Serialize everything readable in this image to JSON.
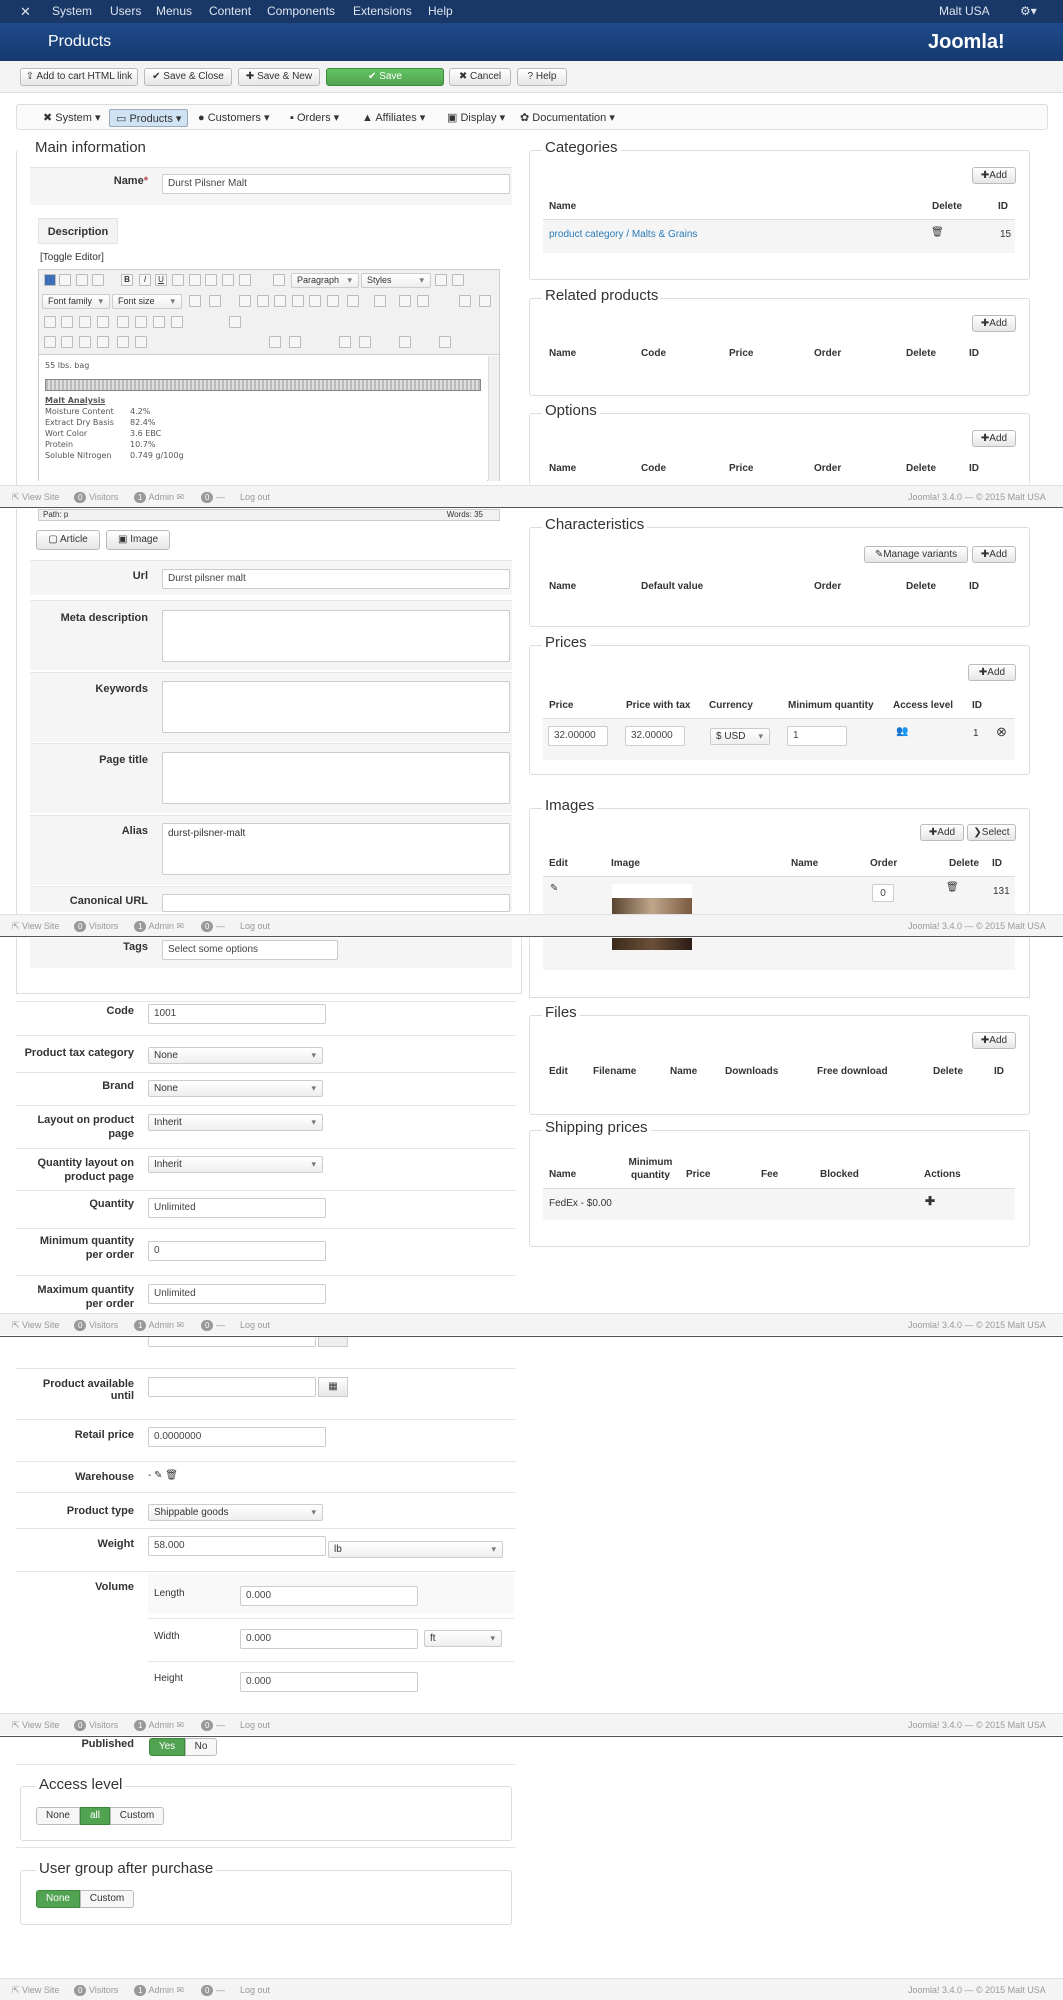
{
  "topnav": {
    "menus": [
      "System",
      "Users",
      "Menus",
      "Content",
      "Components",
      "Extensions",
      "Help"
    ],
    "site": "Malt USA"
  },
  "title": "Products",
  "brand": "Joomla!",
  "toolbar": {
    "add_to_cart": "Add to cart HTML link",
    "save_close": "Save & Close",
    "save_new": "Save & New",
    "save": "Save",
    "cancel": "Cancel",
    "help": "Help"
  },
  "tabs": [
    "System",
    "Products",
    "Customers",
    "Orders",
    "Affiliates",
    "Display",
    "Documentation"
  ],
  "main": {
    "heading": "Main information",
    "name_label": "Name",
    "name_required": "*",
    "name_value": "Durst Pilsner Malt",
    "description_tab": "Description",
    "toggle_editor": "[Toggle Editor]",
    "paragraph_select": "Paragraph",
    "styles_select": "Styles",
    "font_family_select": "Font family",
    "font_size_select": "Font size",
    "editor_lines": {
      "bag": "55 lbs. bag",
      "analysis_title": "Malt Analysis",
      "rows": [
        [
          "Moisture Content",
          "4.2%"
        ],
        [
          "Extract Dry Basis",
          "82.4%"
        ],
        [
          "Wort Color",
          "3.6 EBC"
        ],
        [
          "Protein",
          "10.7%"
        ],
        [
          "Soluble Nitrogen",
          "0.749 g/100g"
        ]
      ]
    },
    "path": "Path:",
    "path_value": "p",
    "words": "Words: 35",
    "article_btn": "Article",
    "image_btn": "Image",
    "url_label": "Url",
    "url_value": "Durst pilsner malt",
    "meta_desc_label": "Meta description",
    "keywords_label": "Keywords",
    "page_title_label": "Page title",
    "alias_label": "Alias",
    "alias_value": "durst-pilsner-malt",
    "canonical_label": "Canonical URL",
    "tags_label": "Tags",
    "tags_placeholder": "Select some options"
  },
  "fields": {
    "code_label": "Code",
    "code_value": "1001",
    "tax_label": "Product tax category",
    "tax_value": "None",
    "brand_label": "Brand",
    "brand_value": "None",
    "layout_label": "Layout on product page",
    "layout_value": "Inherit",
    "qty_layout_label": "Quantity layout on product page",
    "qty_layout_value": "Inherit",
    "quantity_label": "Quantity",
    "quantity_value": "Unlimited",
    "min_qty_label": "Minimum quantity per order",
    "min_qty_value": "0",
    "max_qty_label": "Maximum quantity per order",
    "max_qty_value": "Unlimited",
    "avail_until_label": "Product available until",
    "retail_label": "Retail price",
    "retail_value": "0.0000000",
    "warehouse_label": "Warehouse",
    "warehouse_value": "-",
    "type_label": "Product type",
    "type_value": "Shippable goods",
    "weight_label": "Weight",
    "weight_value": "58.000",
    "weight_unit": "lb",
    "volume_label": "Volume",
    "length_label": "Length",
    "length_value": "0.000",
    "width_label": "Width",
    "width_value": "0.000",
    "width_unit": "ft",
    "height_label": "Height",
    "height_value": "0.000",
    "published_label": "Published",
    "yes": "Yes",
    "no": "No"
  },
  "access": {
    "heading": "Access level",
    "none": "None",
    "all": "all",
    "custom": "Custom"
  },
  "usergroup": {
    "heading": "User group after purchase",
    "none": "None",
    "custom": "Custom"
  },
  "categories": {
    "heading": "Categories",
    "add": "Add",
    "cols": [
      "Name",
      "Delete",
      "ID"
    ],
    "row": {
      "name": "product category / Malts & Grains",
      "id": "15"
    }
  },
  "related": {
    "heading": "Related products",
    "add": "Add",
    "cols": [
      "Name",
      "Code",
      "Price",
      "Order",
      "Delete",
      "ID"
    ]
  },
  "options": {
    "heading": "Options",
    "add": "Add",
    "cols": [
      "Name",
      "Code",
      "Price",
      "Order",
      "Delete",
      "ID"
    ]
  },
  "characteristics": {
    "heading": "Characteristics",
    "manage": "Manage variants",
    "add": "Add",
    "cols": [
      "Name",
      "Default value",
      "Order",
      "Delete",
      "ID"
    ]
  },
  "prices": {
    "heading": "Prices",
    "add": "Add",
    "cols": [
      "Price",
      "Price with tax",
      "Currency",
      "Minimum quantity",
      "Access level",
      "ID"
    ],
    "row": {
      "price": "32.00000",
      "price_tax": "32.00000",
      "currency": "$ USD",
      "min_qty": "1",
      "id": "1"
    }
  },
  "images": {
    "heading": "Images",
    "add": "Add",
    "select": "Select",
    "cols": [
      "Edit",
      "Image",
      "Name",
      "Order",
      "Delete",
      "ID"
    ],
    "row": {
      "order": "0",
      "id": "131"
    }
  },
  "files": {
    "heading": "Files",
    "add": "Add",
    "cols": [
      "Edit",
      "Filename",
      "Name",
      "Downloads",
      "Free download",
      "Delete",
      "ID"
    ]
  },
  "shipping": {
    "heading": "Shipping prices",
    "cols": [
      "Name",
      "Minimum quantity",
      "Price",
      "Fee",
      "Blocked",
      "Actions"
    ],
    "row": {
      "name": "FedEx - $0.00"
    }
  },
  "status": {
    "view_site": "View Site",
    "visitors_count": "0",
    "visitors": "Visitors",
    "admin_count": "1",
    "admin": "Admin",
    "msgs": "0",
    "logout": "Log out",
    "version": "Joomla! 3.4.0 — © 2015 Malt USA"
  },
  "colors": {
    "nav": "#1a3867",
    "green": "#51a351",
    "link": "#2a7ab8"
  }
}
